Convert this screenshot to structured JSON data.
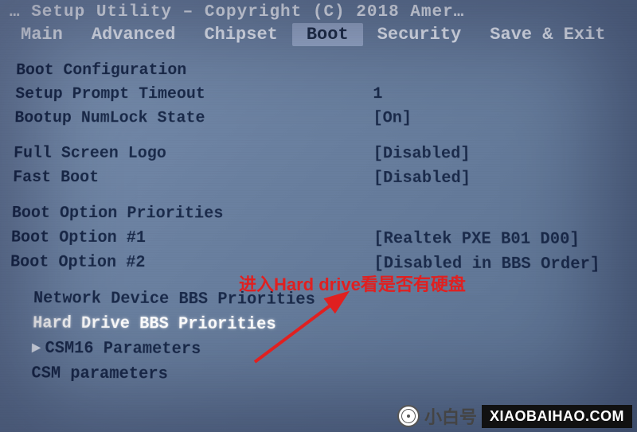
{
  "titlebar": "… Setup Utility – Copyright (C) 2018 Amer…",
  "tabs": {
    "main": "Main",
    "advanced": "Advanced",
    "chipset": "Chipset",
    "boot": "Boot",
    "security": "Security",
    "saveexit": "Save & Exit"
  },
  "boot_cfg": {
    "heading": "Boot Configuration",
    "prompt_timeout_label": "Setup Prompt Timeout",
    "prompt_timeout_value": "1",
    "numlock_label": "Bootup NumLock State",
    "numlock_value": "[On]",
    "fullscreen_label": "Full Screen Logo",
    "fullscreen_value": "[Disabled]",
    "fastboot_label": "Fast Boot",
    "fastboot_value": "[Disabled]"
  },
  "priorities": {
    "heading": "Boot Option Priorities",
    "opt1_label": "Boot Option #1",
    "opt1_value": "[Realtek PXE B01 D00]",
    "opt2_label": "Boot Option #2",
    "opt2_value": "[Disabled in BBS Order]"
  },
  "submenus": {
    "net": "Network Device BBS Priorities",
    "hdd": "Hard Drive BBS Priorities",
    "csm16": "CSM16 Parameters",
    "csm": "CSM parameters"
  },
  "annotation": "进入Hard drive看是否有硬盘",
  "brand": {
    "cn": "小白号",
    "url": "XIAOBAIHAO.COM"
  }
}
